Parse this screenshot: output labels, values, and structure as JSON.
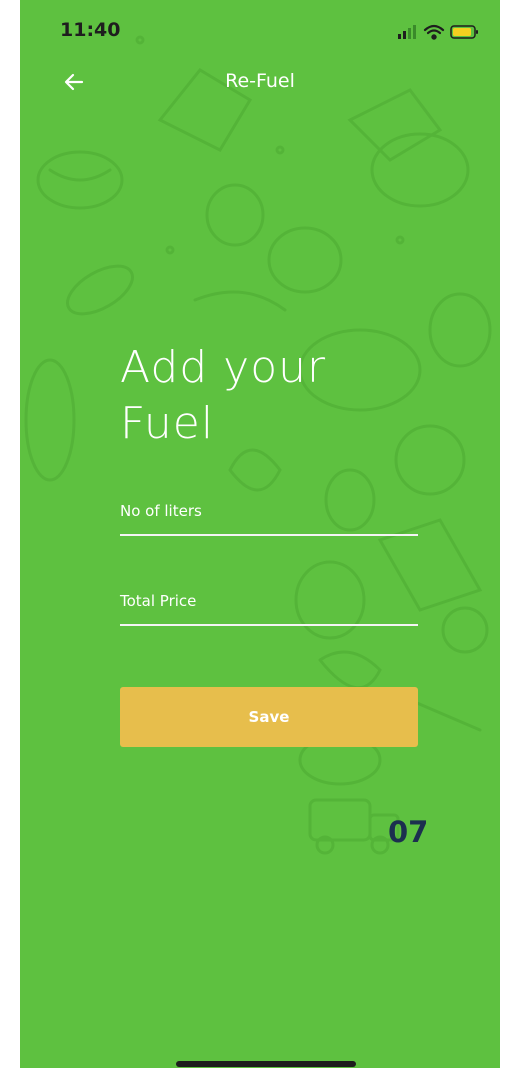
{
  "status_bar": {
    "time": "11:40"
  },
  "nav": {
    "title": "Re-Fuel"
  },
  "form": {
    "heading_line1": "Add your",
    "heading_line2": "Fuel",
    "liters_label": "No of liters",
    "price_label": "Total Price",
    "save_label": "Save"
  },
  "page_number": "07",
  "colors": {
    "background": "#5ec140",
    "button": "#e7be4c",
    "page_number": "#1c2f4f"
  }
}
